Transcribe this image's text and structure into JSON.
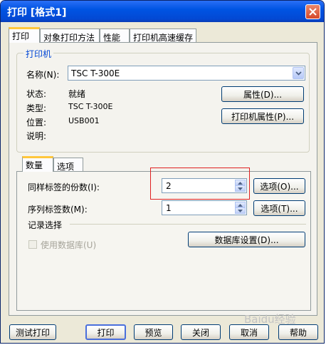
{
  "window": {
    "title": "打印 [格式1]"
  },
  "tabs": [
    "打印",
    "对象打印方法",
    "性能",
    "打印机高速缓存"
  ],
  "printer_group": {
    "title": "打印机",
    "name_label": "名称(N):",
    "name_value": "TSC T-300E",
    "status_label": "状态:",
    "status_value": "就绪",
    "type_label": "类型:",
    "type_value": "TSC T-300E",
    "location_label": "位置:",
    "location_value": "USB001",
    "comment_label": "说明:",
    "properties_button": "属性(D)...",
    "printer_properties_button": "打印机属性(P)..."
  },
  "subtabs": [
    "数量",
    "选项"
  ],
  "quantity": {
    "copies_label": "同样标签的份数(I):",
    "copies_value": "2",
    "copies_options_button": "选项(O)...",
    "serial_label": "序列标签数(M):",
    "serial_value": "1",
    "serial_options_button": "选项(T)...",
    "record_group_title": "记录选择",
    "use_database_label": "使用数据库(U)",
    "database_settings_button": "数据库设置(D)..."
  },
  "buttons": {
    "test_print": "测试打印",
    "print": "打印",
    "preview": "预览",
    "close": "关闭",
    "cancel": "取消",
    "help": "帮助"
  },
  "watermark": "Baidu经验"
}
